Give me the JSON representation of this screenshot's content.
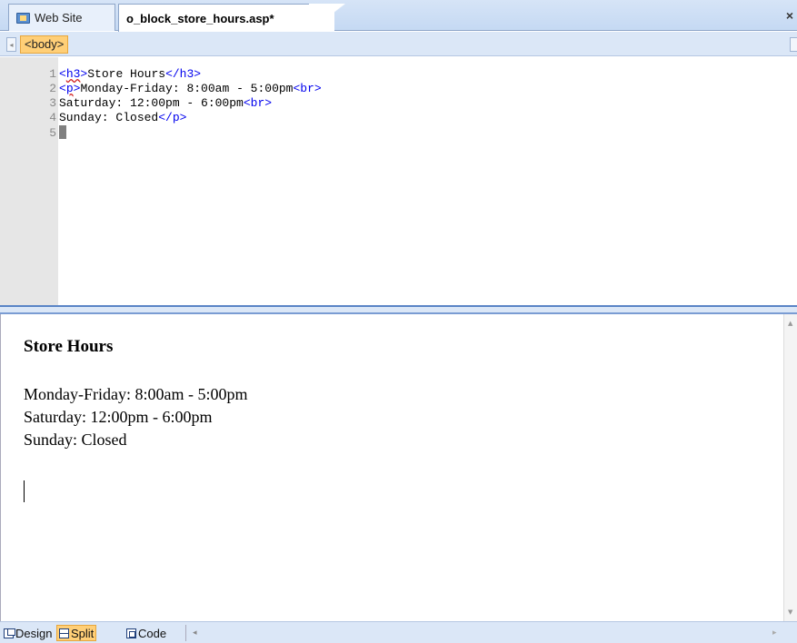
{
  "tabs": {
    "website_label": "Web Site",
    "file_label": "o_block_store_hours.asp*",
    "close_glyph": "×"
  },
  "tagbar": {
    "body_tag": "<body>",
    "left_arrow": "◂"
  },
  "code": {
    "lines": [
      {
        "num": "1",
        "segments": [
          [
            "tag",
            "<"
          ],
          [
            "squig",
            "h3"
          ],
          [
            "tag",
            ">"
          ],
          [
            "text",
            "Store Hours"
          ],
          [
            "tag",
            "</h3>"
          ]
        ]
      },
      {
        "num": "2",
        "segments": [
          [
            "tag",
            "<"
          ],
          [
            "squig",
            "p"
          ],
          [
            "tag",
            ">"
          ],
          [
            "text",
            "Monday-Friday: 8:00am - 5:00pm"
          ],
          [
            "tag",
            "<br>"
          ]
        ]
      },
      {
        "num": "3",
        "segments": [
          [
            "text",
            "Saturday: 12:00pm - 6:00pm"
          ],
          [
            "tag",
            "<br>"
          ]
        ]
      },
      {
        "num": "4",
        "segments": [
          [
            "text",
            "Sunday: Closed"
          ],
          [
            "tag",
            "</p>"
          ]
        ]
      },
      {
        "num": "5",
        "segments": []
      }
    ],
    "colors": {
      "tag": "#0000ee",
      "text": "#000000",
      "squiggle": "#d02020"
    }
  },
  "design": {
    "heading": "Store Hours",
    "lines": [
      "Monday-Friday: 8:00am - 5:00pm",
      "Saturday: 12:00pm - 6:00pm",
      "Sunday: Closed"
    ]
  },
  "viewbar": {
    "design_label": "Design",
    "split_label": "Split",
    "code_label": "Code",
    "active_view": "Split",
    "left_arrow": "◂",
    "right_arrow": "▸"
  }
}
